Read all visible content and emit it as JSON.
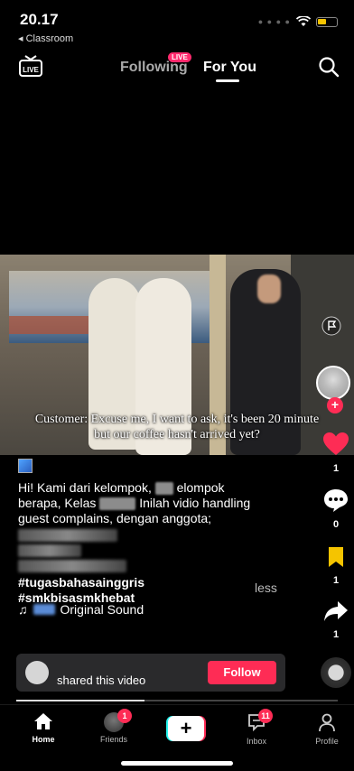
{
  "status_bar": {
    "time": "20.17",
    "back_app": "◂ Classroom",
    "battery_level": 0.45
  },
  "top_nav": {
    "live_label": "LIVE",
    "tab_following": "Following",
    "live_badge": "LIVE",
    "tab_for_you": "For You"
  },
  "video": {
    "subtitle_line1": "Customer: Excuse me, I want to ask, it's been 20 minute",
    "subtitle_line2": "but our coffee hasn't arrived yet?"
  },
  "rail": {
    "like_count": "1",
    "comment_count": "0",
    "favorite_count": "1",
    "share_count": "1"
  },
  "caption": {
    "text_1": "Hi! Kami dari kelompok,",
    "text_2": "elompok",
    "text_3": "berapa, Kelas",
    "text_4": "Inilah vidio handling",
    "text_5": "guest complains, dengan anggota;",
    "hashtag_1": "#tugasbahasainggris",
    "hashtag_2": "#smkbisasmkhebat",
    "less": "less"
  },
  "sound": {
    "label": "Original Sound"
  },
  "shared": {
    "text": "shared this video",
    "follow_label": "Follow"
  },
  "progress": 0.4,
  "bottom_nav": {
    "home": "Home",
    "friends": "Friends",
    "friends_badge": "1",
    "inbox": "Inbox",
    "inbox_badge": "11",
    "profile": "Profile"
  }
}
